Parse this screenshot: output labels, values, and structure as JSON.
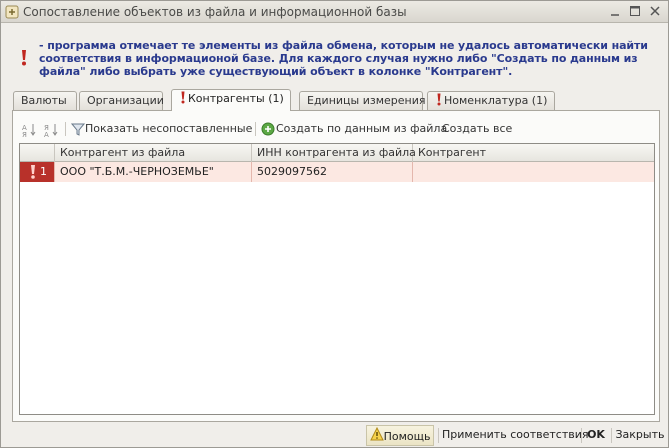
{
  "window": {
    "title": "Сопоставление объектов из файла и информационной базы"
  },
  "info": {
    "text": "- программа отмечает те элементы из файла обмена, которым не удалось автоматически найти соответствия в информационой базе. Для каждого случая нужно либо \"Создать по данным из файла\" либо выбрать уже существующий объект в колонке \"Контрагент\"."
  },
  "tabs": [
    {
      "label": "Валюты",
      "flagged": false,
      "active": false
    },
    {
      "label": "Организации",
      "flagged": false,
      "active": false
    },
    {
      "label": "Контрагенты (1)",
      "flagged": true,
      "active": true
    },
    {
      "label": "Единицы измерения",
      "flagged": false,
      "active": false
    },
    {
      "label": "Номенклатура (1)",
      "flagged": true,
      "active": false
    }
  ],
  "toolbar": {
    "show_unmatched": "Показать несопоставленные",
    "create_from_file": "Создать по данным из файла",
    "create_all": "Создать все"
  },
  "grid": {
    "columns": [
      "",
      "Контрагент из файла",
      "ИНН контрагента из файла",
      "Контрагент"
    ],
    "rows": [
      {
        "num": "1",
        "contractor_from_file": "ООО \"Т.Б.М.-ЧЕРНОЗЕМЬЕ\"",
        "inn": "5029097562",
        "contractor": ""
      }
    ]
  },
  "statusbar": {
    "help": "Помощь",
    "apply": "Применить соответствия",
    "ok": "OK",
    "close": "Закрыть"
  },
  "colors": {
    "info_text": "#2a3a8e",
    "flag_red": "#c0271f",
    "row_highlight": "#fce8e2"
  }
}
